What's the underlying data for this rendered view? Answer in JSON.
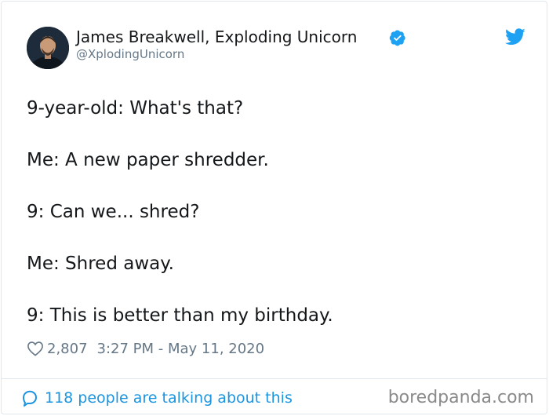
{
  "tweet": {
    "author_name": "James Breakwell, Exploding Unicorn",
    "author_handle": "@XplodingUnicorn",
    "lines": [
      "9-year-old: What's that?",
      "Me: A new paper shredder.",
      "9: Can we... shred?",
      "Me: Shred away.",
      "9: This is better than my birthday."
    ],
    "likes": "2,807",
    "timestamp": "3:27 PM - May 11, 2020",
    "talking_text": "118 people are talking about this"
  },
  "watermark": "boredpanda.com",
  "icons": {
    "verified": "verified-badge-icon",
    "bird": "twitter-bird-icon",
    "heart": "heart-icon",
    "bubble": "speech-bubble-icon"
  },
  "colors": {
    "twitter_blue": "#1da1f2",
    "link_blue": "#1b95e0",
    "text_primary": "#14171a",
    "text_secondary": "#657786",
    "border": "#e1e8ed"
  }
}
